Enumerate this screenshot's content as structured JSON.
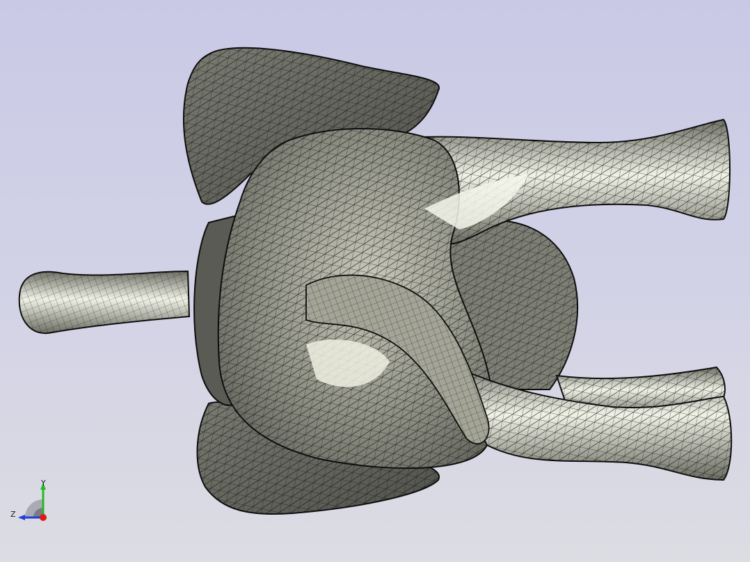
{
  "viewport": {
    "title": "",
    "background_top": "#c9c9e6",
    "background_bottom": "#dcdce3"
  },
  "model": {
    "name": "",
    "display_mode": "shaded-with-mesh-edges",
    "shade_color": "#8a8b7e",
    "highlight_color": "#f4f5ea",
    "edge_color": "#111111"
  },
  "axis_triad": {
    "y_label": "Y",
    "z_label": "Z",
    "y_color": "#22bb22",
    "z_color": "#1e3fd8",
    "x_color": "#e01818"
  }
}
